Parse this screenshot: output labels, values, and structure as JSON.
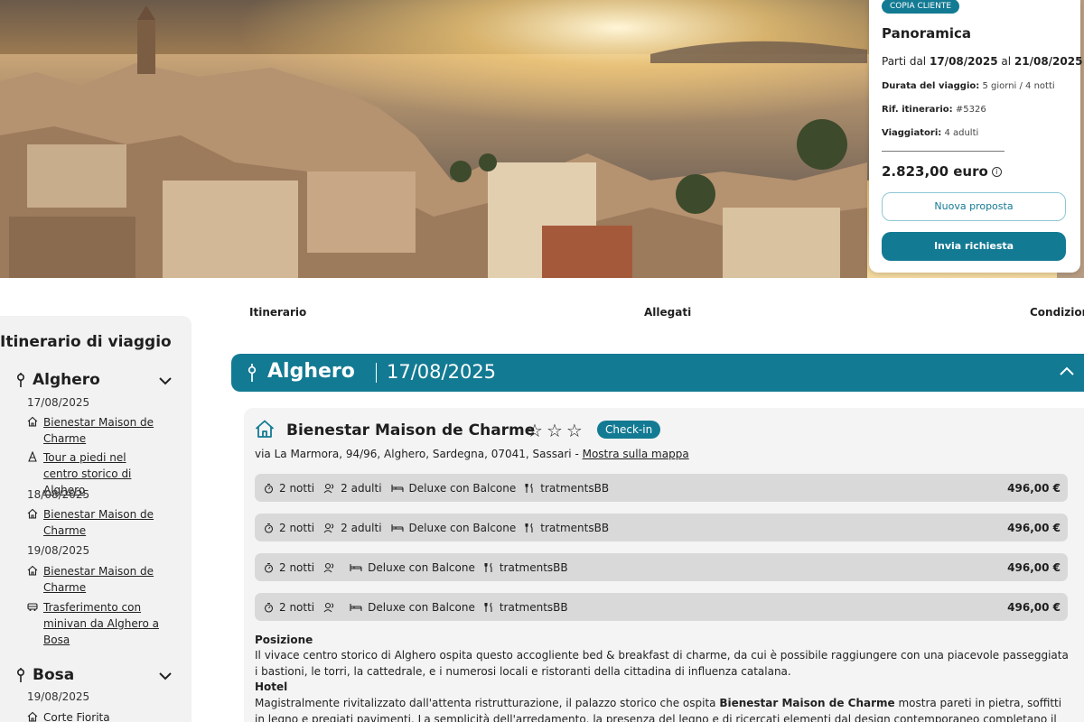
{
  "summary": {
    "badge": "COPIA CLIENTE",
    "title": "Panoramica",
    "dates_prefix": "Parti dal",
    "start_date": "17/08/2025",
    "dates_mid": "al",
    "end_date": "21/08/2025",
    "duration_label": "Durata del viaggio:",
    "duration_value": "5 giorni / 4 notti",
    "ref_label": "Rif. itinerario:",
    "ref_value": "#5326",
    "travellers_label": "Viaggiatori:",
    "travellers_value": "4 adulti",
    "price": "2.823,00 euro",
    "btn_new": "Nuova proposta",
    "btn_send": "Invia richiesta"
  },
  "tabs": [
    "Itinerario",
    "Allegati",
    "Condizioni"
  ],
  "sidebar": {
    "title": "Itinerario di viaggio",
    "alghero": {
      "city": "Alghero",
      "day1": "17/08/2025",
      "item1": "Bienestar Maison de Charme",
      "item2": "Tour a piedi nel centro storico di Alghero",
      "day2": "18/08/2025",
      "item3": "Bienestar Maison de Charme",
      "day3": "19/08/2025",
      "item4": "Bienestar Maison de Charme",
      "item5": "Trasferimento con minivan da Alghero a Bosa"
    },
    "bosa": {
      "city": "Bosa",
      "day1": "19/08/2025",
      "item1": "Corte Fiorita"
    }
  },
  "citybar": {
    "city": "Alghero",
    "date": "17/08/2025"
  },
  "hotel": {
    "name": "Bienestar Maison de Charme",
    "checkin": "Check-in",
    "address": "via La Marmora, 94/96, Alghero, Sardegna, 07041, Sassari -",
    "map_link": "Mostra sulla mappa",
    "rooms": [
      {
        "nights": "2 notti",
        "guests": "2 adulti",
        "room": "Deluxe con Balcone",
        "board": "tratmentsBB",
        "price": "496,00 €"
      },
      {
        "nights": "2 notti",
        "guests": "2 adulti",
        "room": "Deluxe con Balcone",
        "board": "tratmentsBB",
        "price": "496,00 €"
      },
      {
        "nights": "2 notti",
        "guests": "",
        "room": "Deluxe con Balcone",
        "board": "tratmentsBB",
        "price": "496,00 €"
      },
      {
        "nights": "2 notti",
        "guests": "",
        "room": "Deluxe con Balcone",
        "board": "tratmentsBB",
        "price": "496,00 €"
      }
    ],
    "position_title": "Posizione",
    "position_text": "Il vivace centro storico di Alghero ospita questo accogliente bed & breakfast di charme, da cui è possibile raggiungere con una piacevole passeggiata i bastioni, le torri, la cattedrale, e i numerosi locali e ristoranti della cittadina di influenza catalana.",
    "hotel_title": "Hotel",
    "hotel_text_1": "Magistralmente rivitalizzato dall'attenta ristrutturazione, il palazzo storico che ospita ",
    "hotel_text_bold": "Bienestar Maison de Charme",
    "hotel_text_2": " mostra pareti in pietra, soffitti in legno e pregiati pavimenti. La semplicità dell'arredamento, la presenza del legno e di ricercati elementi dal design contemporaneo completano il quadro."
  },
  "colors": {
    "accent": "#137a93",
    "row_bg": "#d9d9d9"
  }
}
